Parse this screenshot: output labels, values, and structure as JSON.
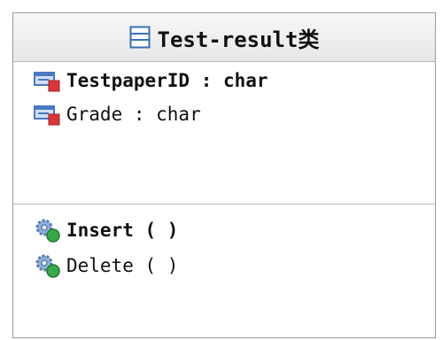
{
  "class": {
    "name": "Test-result类",
    "attributes": [
      {
        "text": "TestpaperID : char",
        "icon": "attribute-icon"
      },
      {
        "text": "Grade : char",
        "icon": "attribute-icon"
      }
    ],
    "operations": [
      {
        "text": "Insert ( )",
        "icon": "operation-icon"
      },
      {
        "text": "Delete ( )",
        "icon": "operation-icon"
      }
    ]
  },
  "colors": {
    "header_top": "#f7f7f7",
    "header_bottom": "#e8e8e8",
    "border": "#9a9a9a",
    "class_icon": "#3a6fb5",
    "attribute_icon_blue": "#4a78c2",
    "attribute_icon_red": "#d9363b",
    "operation_icon_gear": "#5a7fb0",
    "operation_icon_green": "#3aa84a"
  }
}
